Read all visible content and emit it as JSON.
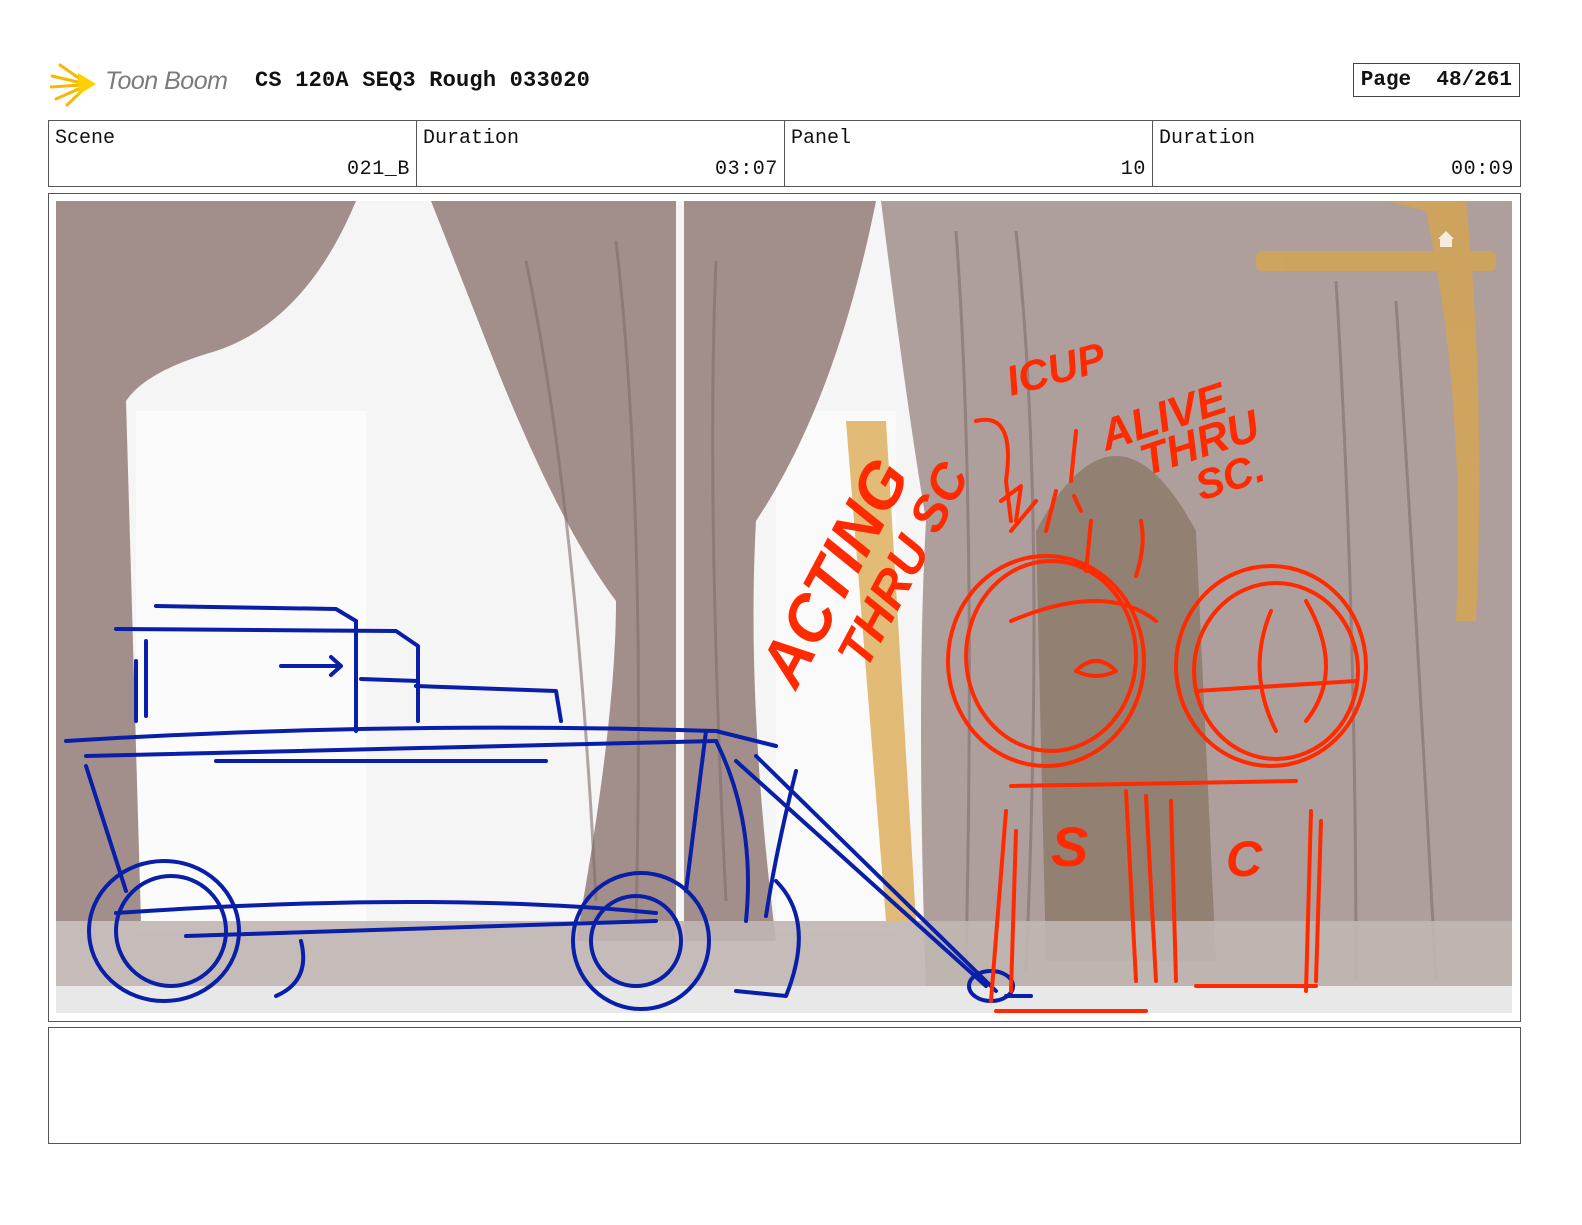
{
  "header": {
    "logo_text": "Toon Boom",
    "document_title": "CS 120A SEQ3 Rough 033020",
    "page_label": "Page",
    "page_value": "48/261"
  },
  "meta": {
    "scene_label": "Scene",
    "scene_value": "021_B",
    "scene_duration_label": "Duration",
    "scene_duration_value": "03:07",
    "panel_label": "Panel",
    "panel_value": "10",
    "panel_duration_label": "Duration",
    "panel_duration_value": "00:09"
  },
  "panel": {
    "annotations": {
      "acting": "ACTING",
      "thru_sc": "THRU SC",
      "icup": "ICUP",
      "alive": "ALIVE",
      "thru": "THRU",
      "sc": "SC.",
      "s": "S",
      "c": "C"
    },
    "colors": {
      "blue_sketch": "#0a1fa8",
      "red_sketch": "#ff2a00",
      "curtain": "#9e8a86",
      "background": "#f4f4f4",
      "chair": "#d9a54a"
    }
  },
  "notes": {
    "text": ""
  }
}
